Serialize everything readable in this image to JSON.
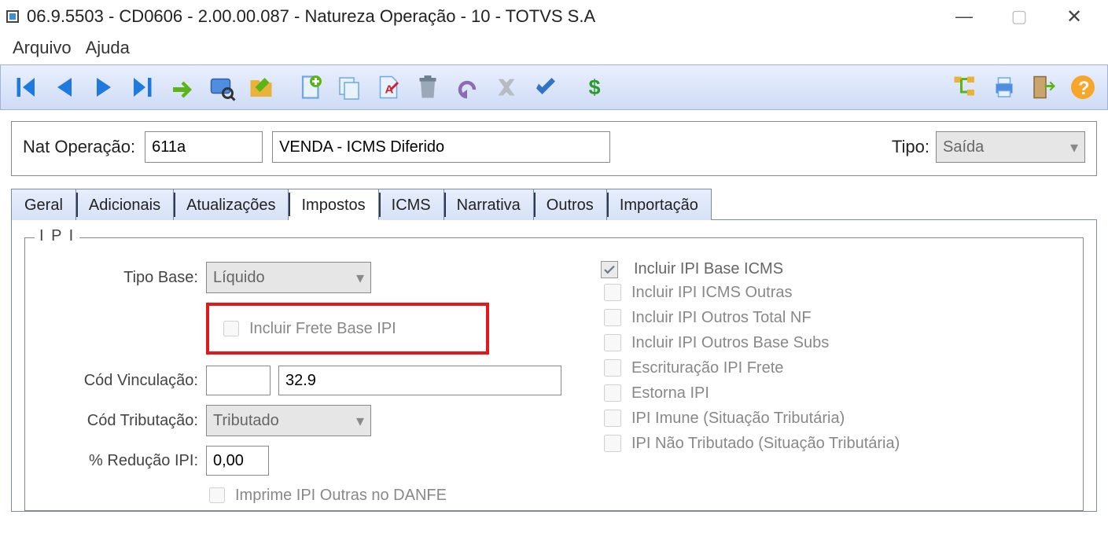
{
  "window": {
    "title": "06.9.5503 - CD0606 - 2.00.00.087 - Natureza Operação - 10 - TOTVS S.A"
  },
  "menu": {
    "arquivo": "Arquivo",
    "ajuda": "Ajuda"
  },
  "toolbar_icons": {
    "first": "first-icon",
    "prev": "prev-icon",
    "next": "next-icon",
    "last": "last-icon",
    "goto": "goto-icon",
    "search": "search-icon",
    "folderprops": "folder-properties-icon",
    "new": "new-icon",
    "copy": "copy-icon",
    "rename": "rename-icon",
    "delete": "delete-icon",
    "undo": "undo-icon",
    "cancel": "cancel-icon",
    "confirm": "confirm-icon",
    "currency": "currency-icon",
    "tree": "tree-icon",
    "print": "print-icon",
    "exit": "exit-icon",
    "help": "help-icon"
  },
  "header": {
    "nat_operacao_label": "Nat Operação:",
    "nat_operacao_code": "611a",
    "nat_operacao_desc": "VENDA - ICMS Diferido",
    "tipo_label": "Tipo:",
    "tipo_value": "Saída"
  },
  "tabs": [
    {
      "label": "Geral"
    },
    {
      "label": "Adicionais"
    },
    {
      "label": "Atualizações"
    },
    {
      "label": "Impostos",
      "active": true
    },
    {
      "label": "ICMS"
    },
    {
      "label": "Narrativa"
    },
    {
      "label": "Outros"
    },
    {
      "label": "Importação"
    }
  ],
  "ipi": {
    "legend": "I P I",
    "tipo_base_label": "Tipo Base:",
    "tipo_base_value": "Líquido",
    "incluir_frete_label": "Incluir Frete Base IPI",
    "cod_vinculacao_label": "Cód Vinculação:",
    "cod_vinculacao_code": "",
    "cod_vinculacao_val": "32.9",
    "cod_tributacao_label": "Cód Tributação:",
    "cod_tributacao_value": "Tributado",
    "perc_reducao_label": "% Redução IPI:",
    "perc_reducao_value": "0,00",
    "imprime_danfe_label": "Imprime IPI Outras no DANFE",
    "checks": [
      {
        "label": "Incluir IPI Base ICMS",
        "checked": true
      },
      {
        "label": "Incluir IPI ICMS Outras",
        "checked": false
      },
      {
        "label": "Incluir IPI Outros Total NF",
        "checked": false
      },
      {
        "label": "Incluir IPI Outros Base Subs",
        "checked": false
      },
      {
        "label": "Escrituração IPI Frete",
        "checked": false
      },
      {
        "label": "Estorna IPI",
        "checked": false
      },
      {
        "label": "IPI Imune (Situação Tributária)",
        "checked": false
      },
      {
        "label": "IPI Não Tributado (Situação Tributária)",
        "checked": false
      }
    ]
  }
}
